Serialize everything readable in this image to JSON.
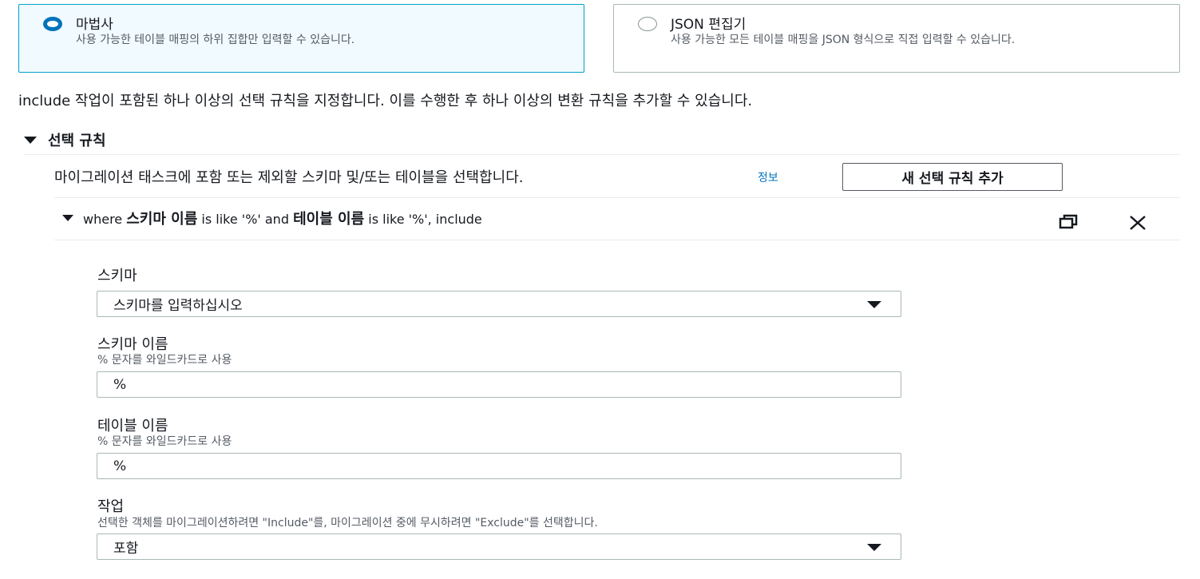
{
  "mode_tiles": [
    {
      "title": "마법사",
      "description": "사용 가능한 테이블 매핑의 하위 집합만 입력할 수 있습니다.",
      "selected": true
    },
    {
      "title": "JSON 편집기",
      "description": "사용 가능한 모든 테이블 매핑을 JSON 형식으로 직접 입력할 수 있습니다.",
      "selected": false
    }
  ],
  "intro_text": "include 작업이 포함된 하나 이상의 선택 규칙을 지정합니다. 이를 수행한 후 하나 이상의 변환 규칙을 추가할 수 있습니다.",
  "selection_rules": {
    "header": "선택 규칙",
    "description": "마이그레이션 태스크에 포함 또는 제외할 스키마 및/또는 테이블을 선택합니다.",
    "info_link": "정보",
    "add_button": "새 선택 규칙 추가"
  },
  "rule": {
    "summary_where": "where",
    "summary_schema": "스키마 이름",
    "summary_like1": "is like '%' and",
    "summary_table": "테이블 이름",
    "summary_like2": "is like '%', include",
    "copy_icon": "copy-icon",
    "close_icon": "close-icon"
  },
  "fields": {
    "schema": {
      "label": "스키마",
      "value": "스키마를 입력하십시오"
    },
    "schema_name": {
      "label": "스키마 이름",
      "hint": "% 문자를 와일드카드로 사용",
      "value": "%"
    },
    "table_name": {
      "label": "테이블 이름",
      "hint": "% 문자를 와일드카드로 사용",
      "value": "%"
    },
    "action": {
      "label": "작업",
      "hint": "선택한 객체를 마이그레이션하려면 \"Include\"를, 마이그레이션 중에 무시하려면 \"Exclude\"를 선택합니다.",
      "value": "포함"
    }
  },
  "colors": {
    "accent": "#0073bb",
    "selected_bg": "#f1faff",
    "border": "#aab7b8"
  }
}
